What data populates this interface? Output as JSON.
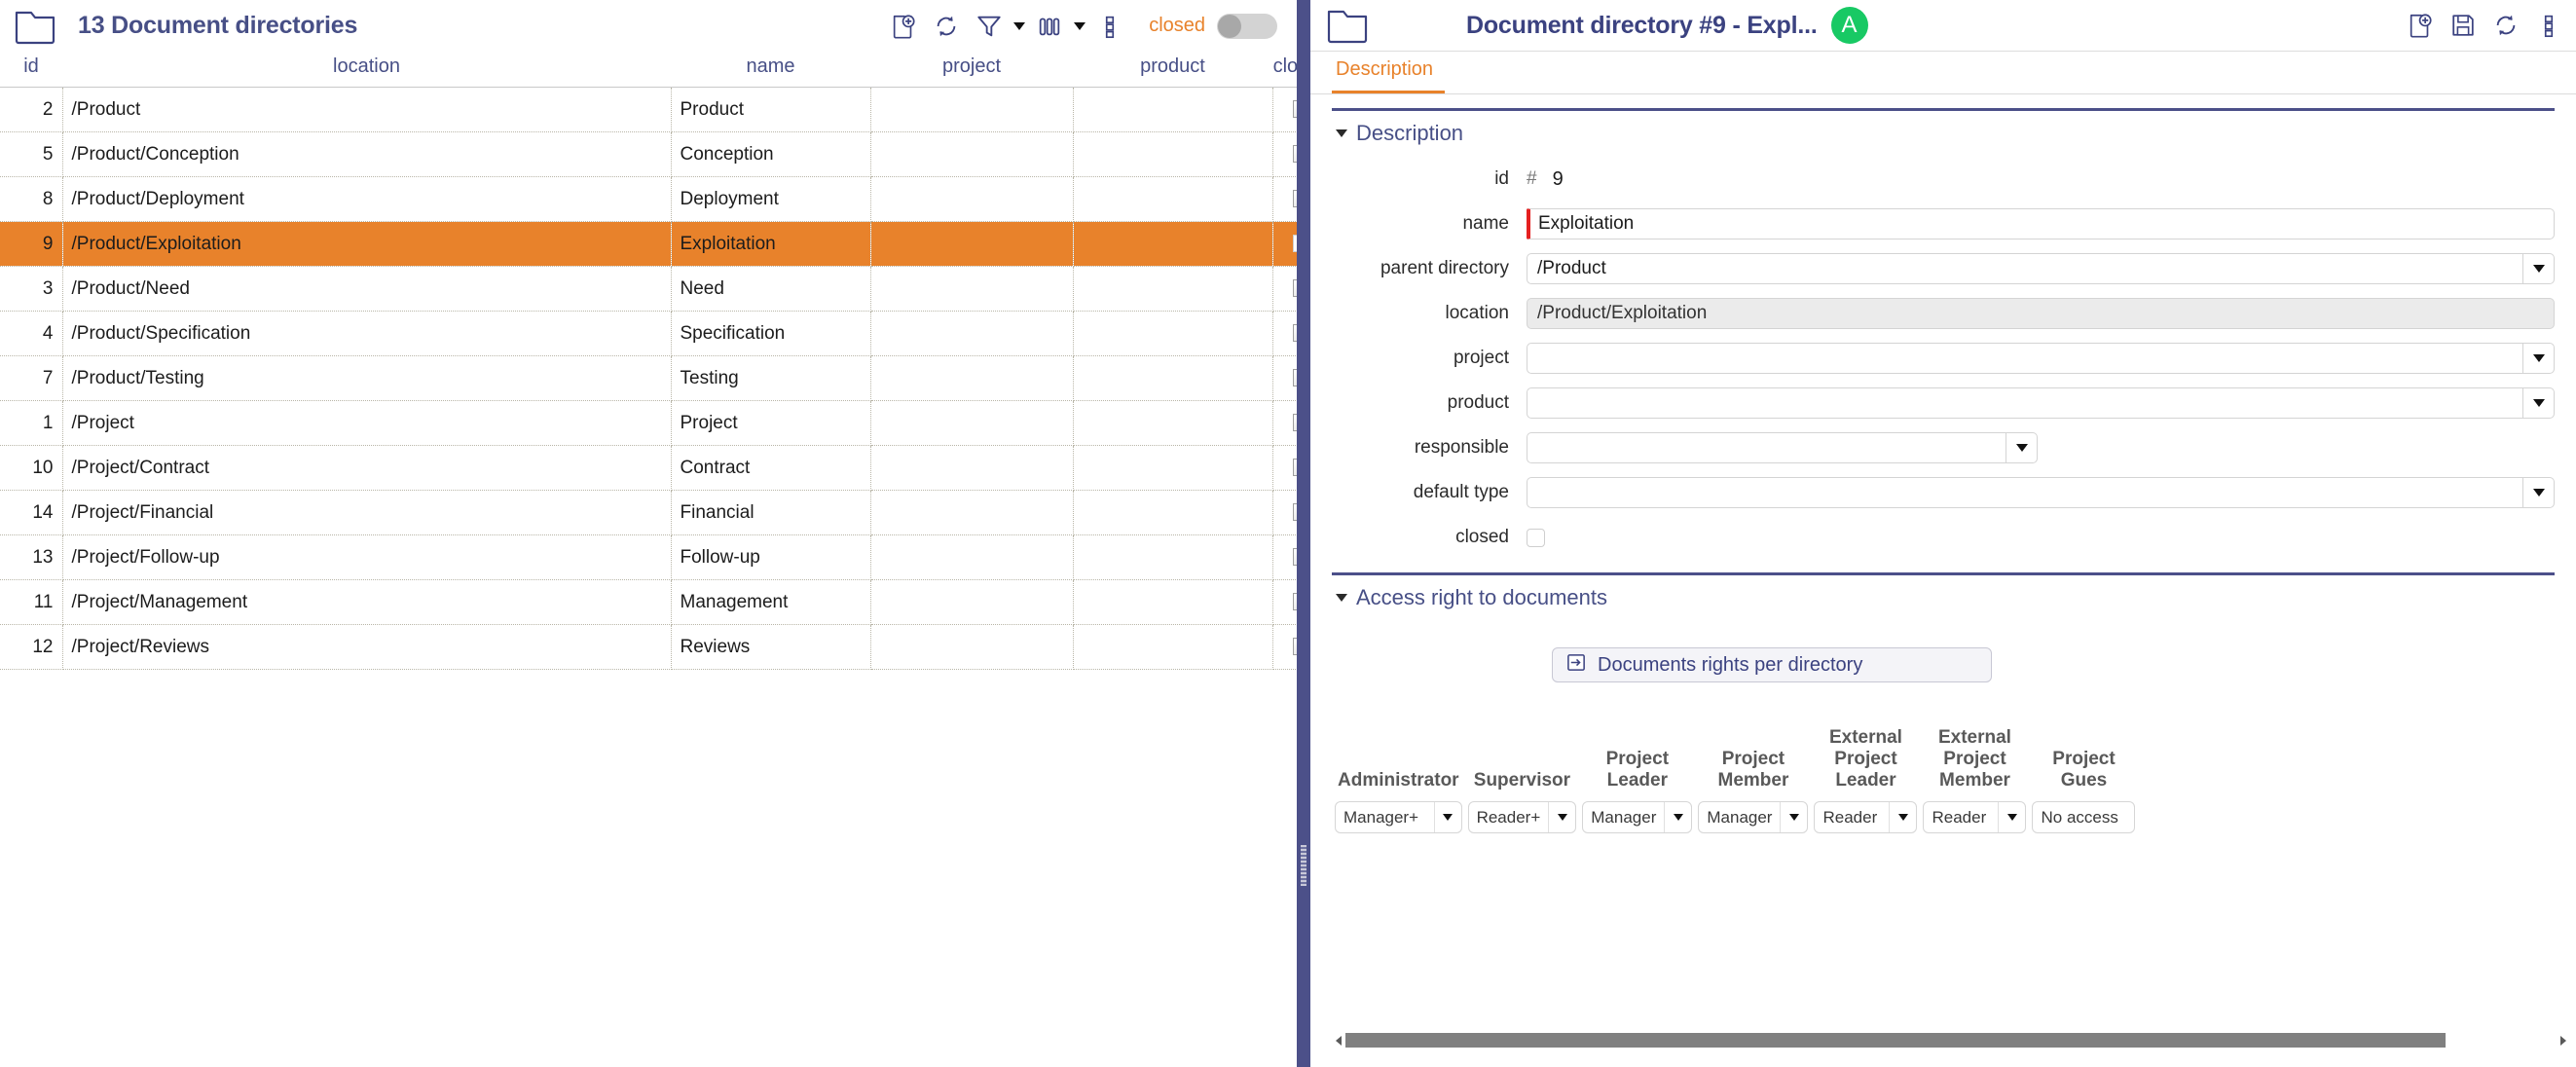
{
  "left": {
    "title": "13 Document directories",
    "folder_icon": "folder-icon",
    "toolbar": {
      "new_icon": "new-document-icon",
      "refresh_icon": "refresh-icon",
      "filter_icon": "filter-icon",
      "filter_caret_icon": "chevron-down-icon",
      "columns_icon": "columns-icon",
      "columns_caret_icon": "chevron-down-icon",
      "more_icon": "more-vertical-icon",
      "closed_label": "closed",
      "closed_toggle": "off"
    },
    "columns": [
      "id",
      "location",
      "name",
      "project",
      "product",
      "closed"
    ],
    "rows": [
      {
        "id": "2",
        "location": "/Product",
        "name": "Product",
        "project": "",
        "product": "",
        "closed": false,
        "selected": false
      },
      {
        "id": "5",
        "location": "/Product/Conception",
        "name": "Conception",
        "project": "",
        "product": "",
        "closed": false,
        "selected": false
      },
      {
        "id": "8",
        "location": "/Product/Deployment",
        "name": "Deployment",
        "project": "",
        "product": "",
        "closed": false,
        "selected": false
      },
      {
        "id": "9",
        "location": "/Product/Exploitation",
        "name": "Exploitation",
        "project": "",
        "product": "",
        "closed": false,
        "selected": true
      },
      {
        "id": "3",
        "location": "/Product/Need",
        "name": "Need",
        "project": "",
        "product": "",
        "closed": false,
        "selected": false
      },
      {
        "id": "4",
        "location": "/Product/Specification",
        "name": "Specification",
        "project": "",
        "product": "",
        "closed": false,
        "selected": false
      },
      {
        "id": "7",
        "location": "/Product/Testing",
        "name": "Testing",
        "project": "",
        "product": "",
        "closed": false,
        "selected": false
      },
      {
        "id": "1",
        "location": "/Project",
        "name": "Project",
        "project": "",
        "product": "",
        "closed": false,
        "selected": false
      },
      {
        "id": "10",
        "location": "/Project/Contract",
        "name": "Contract",
        "project": "",
        "product": "",
        "closed": false,
        "selected": false
      },
      {
        "id": "14",
        "location": "/Project/Financial",
        "name": "Financial",
        "project": "",
        "product": "",
        "closed": false,
        "selected": false
      },
      {
        "id": "13",
        "location": "/Project/Follow-up",
        "name": "Follow-up",
        "project": "",
        "product": "",
        "closed": false,
        "selected": false
      },
      {
        "id": "11",
        "location": "/Project/Management",
        "name": "Management",
        "project": "",
        "product": "",
        "closed": false,
        "selected": false
      },
      {
        "id": "12",
        "location": "/Project/Reviews",
        "name": "Reviews",
        "project": "",
        "product": "",
        "closed": false,
        "selected": false
      }
    ]
  },
  "right": {
    "title": "Document directory  #9  - Expl...",
    "folder_icon": "folder-icon",
    "avatar_letter": "A",
    "avatar_color": "#18c964",
    "toolbar": {
      "new_icon": "new-document-icon",
      "save_icon": "save-icon",
      "refresh_icon": "refresh-icon",
      "more_icon": "more-vertical-icon"
    },
    "tabs": [
      {
        "label": "Description",
        "active": true
      }
    ],
    "description_section": {
      "title": "Description",
      "fields": {
        "id_label": "id",
        "id_hash": "#",
        "id_value": "9",
        "name_label": "name",
        "name_value": "Exploitation",
        "parent_directory_label": "parent directory",
        "parent_directory_value": "/Product",
        "location_label": "location",
        "location_value": "/Product/Exploitation",
        "project_label": "project",
        "project_value": "",
        "product_label": "product",
        "product_value": "",
        "responsible_label": "responsible",
        "responsible_value": "",
        "default_type_label": "default type",
        "default_type_value": "",
        "closed_label": "closed",
        "closed_checked": false
      }
    },
    "access_section": {
      "title": "Access right to documents",
      "rights_button": {
        "label": "Documents rights per directory",
        "icon": "arrow-in-box-icon"
      },
      "rights_table": {
        "columns": [
          "Administrator",
          "Supervisor",
          "Project\nLeader",
          "Project\nMember",
          "External\nProject\nLeader",
          "External\nProject\nMember",
          "Project Gues"
        ],
        "values": [
          "Manager+",
          "Reader+",
          "Manager",
          "Manager",
          "Reader",
          "Reader",
          "No access"
        ]
      }
    },
    "hscrollbar": {
      "left_arrow_icon": "chevron-left-icon",
      "right_arrow_icon": "chevron-right-icon"
    }
  },
  "colors": {
    "accent_orange": "#e8822b",
    "brand_indigo": "#4c5089",
    "title_indigo": "#474f86",
    "required_red": "#e52020",
    "avatar_green": "#18c964"
  }
}
